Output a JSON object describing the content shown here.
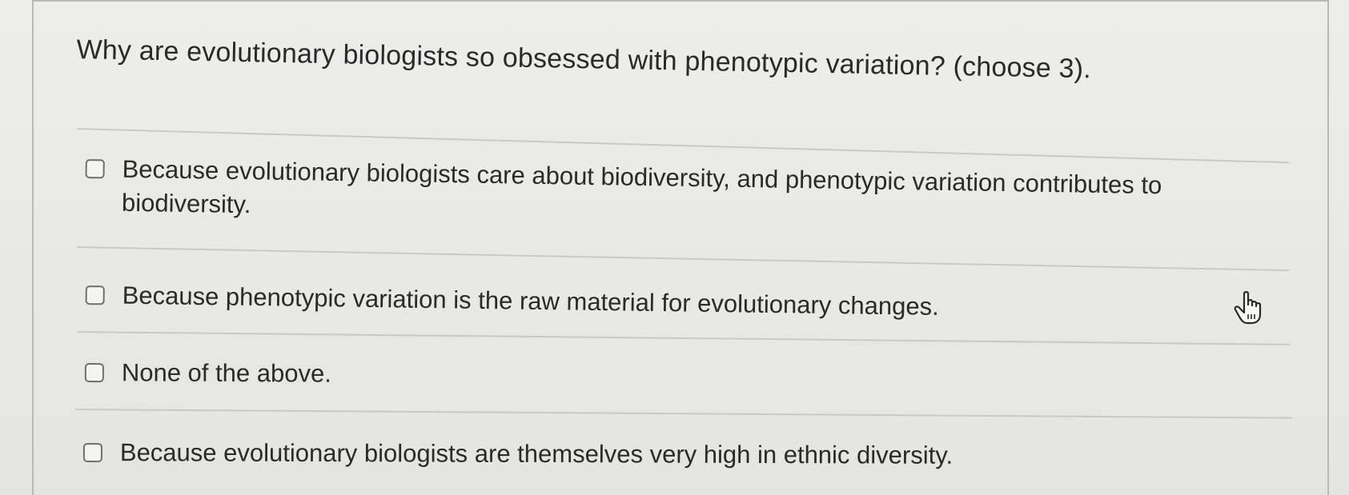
{
  "question": {
    "text": "Why are evolutionary biologists so obsessed with phenotypic variation? (choose 3)."
  },
  "options": [
    {
      "label": "Because evolutionary biologists care about biodiversity, and phenotypic variation contributes to biodiversity.",
      "checked": false
    },
    {
      "label": "Because phenotypic variation is the raw material for evolutionary changes.",
      "checked": false
    },
    {
      "label": "None of the above.",
      "checked": false
    },
    {
      "label": "Because evolutionary biologists are themselves very high in ethnic diversity.",
      "checked": false
    }
  ],
  "cursor": {
    "icon": "hand-pointer-icon"
  }
}
